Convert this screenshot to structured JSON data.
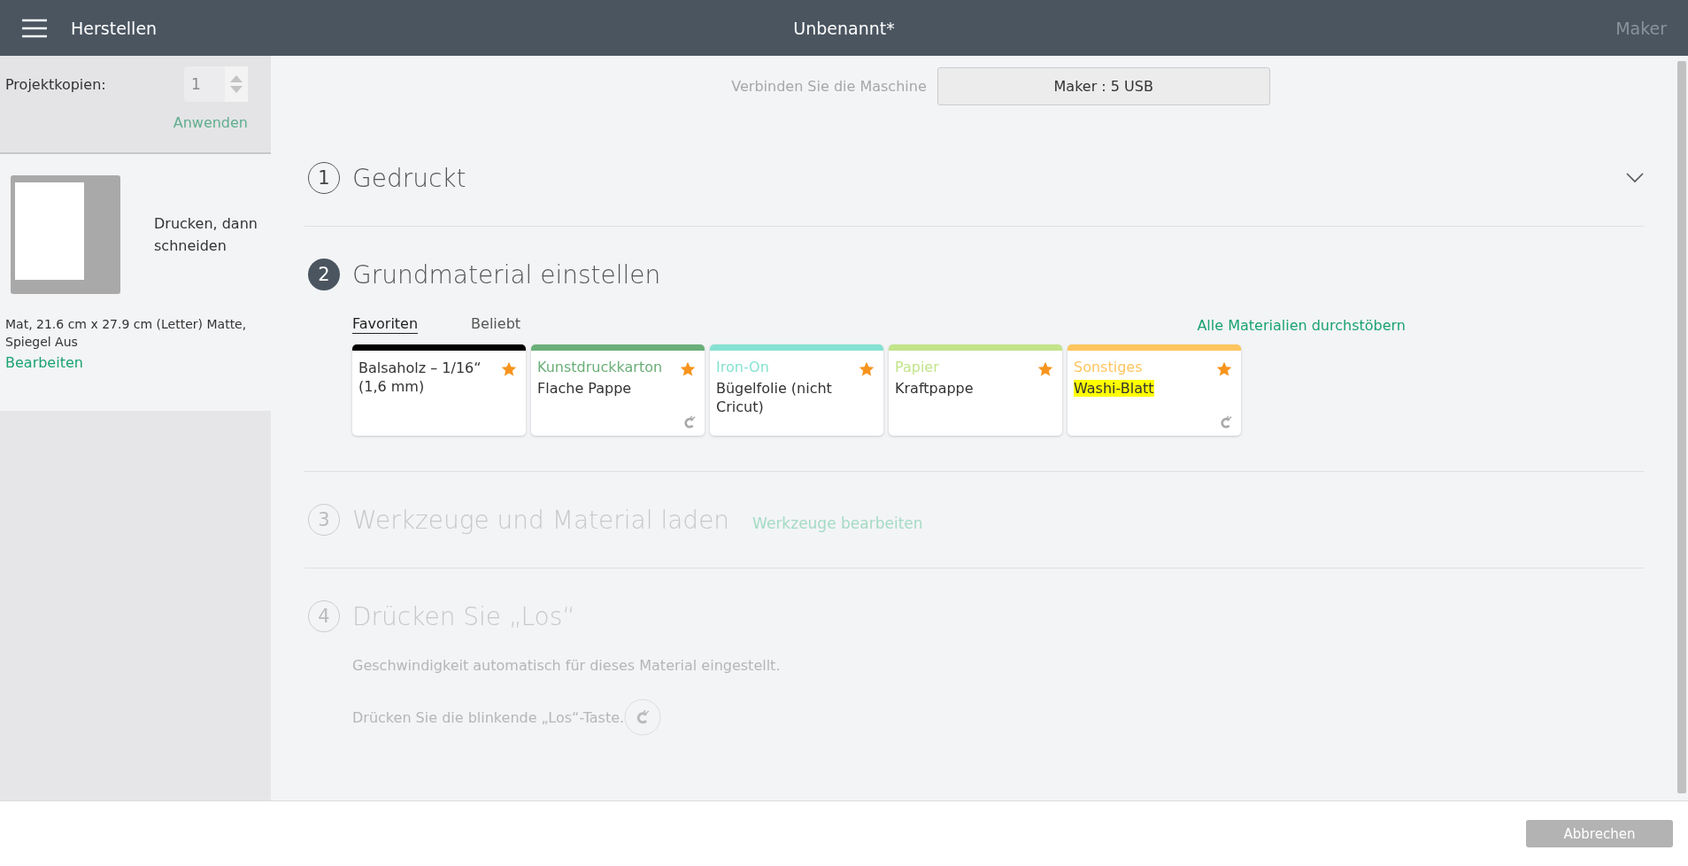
{
  "header": {
    "menu_title": "Herstellen",
    "title": "Unbenannt*",
    "machine": "Maker"
  },
  "sidebar": {
    "copies_label": "Projektkopien:",
    "copies_value": "1",
    "apply": "Anwenden",
    "mat_title": "Drucken, dann schneiden",
    "mat_info": "Mat, 21.6 cm x 27.9 cm (Letter) Matte, Spiegel Aus",
    "edit": "Bearbeiten"
  },
  "connect": {
    "label": "Verbinden Sie die Maschine",
    "button": "Maker : 5 USB"
  },
  "steps": [
    {
      "number": "1",
      "title": "Gedruckt",
      "current": false,
      "disabled": false
    },
    {
      "number": "2",
      "title": "Grundmaterial einstellen",
      "current": true,
      "disabled": false
    },
    {
      "number": "3",
      "title": "Werkzeuge und Material laden",
      "current": false,
      "disabled": true,
      "link": "Werkzeuge bearbeiten"
    },
    {
      "number": "4",
      "title": "Drücken Sie „Los“",
      "current": false,
      "disabled": true,
      "lines": [
        "Geschwindigkeit automatisch für dieses Material eingestellt.",
        "Drücken Sie die blinkende „Los“-Taste."
      ]
    }
  ],
  "material_tabs": [
    {
      "label": "Favoriten",
      "selected": true
    },
    {
      "label": "Beliebt",
      "selected": false
    }
  ],
  "browse_link": "Alle Materialien durchstöbern",
  "materials": [
    {
      "name": "Balsaholz – 1/16“ (1,6 mm)",
      "color": "#000000",
      "starred": true,
      "cricut": false,
      "highlighted": false
    },
    {
      "category": "Kunstdruckkarton",
      "name": "Flache Pappe",
      "color": "#6aaf78",
      "starred": true,
      "cricut": true,
      "highlighted": false
    },
    {
      "category": "Iron-On",
      "name": "Bügelfolie (nicht Cricut)",
      "color": "#86e2d2",
      "starred": true,
      "cricut": false,
      "highlighted": false
    },
    {
      "category": "Papier",
      "name": "Kraftpappe",
      "color": "#c2e48a",
      "starred": true,
      "cricut": false,
      "highlighted": false
    },
    {
      "category": "Sonstiges",
      "name": "Washi-Blatt",
      "color": "#fec55e",
      "starred": true,
      "cricut": true,
      "highlighted": true
    }
  ],
  "footer": {
    "cancel": "Abbrechen"
  }
}
